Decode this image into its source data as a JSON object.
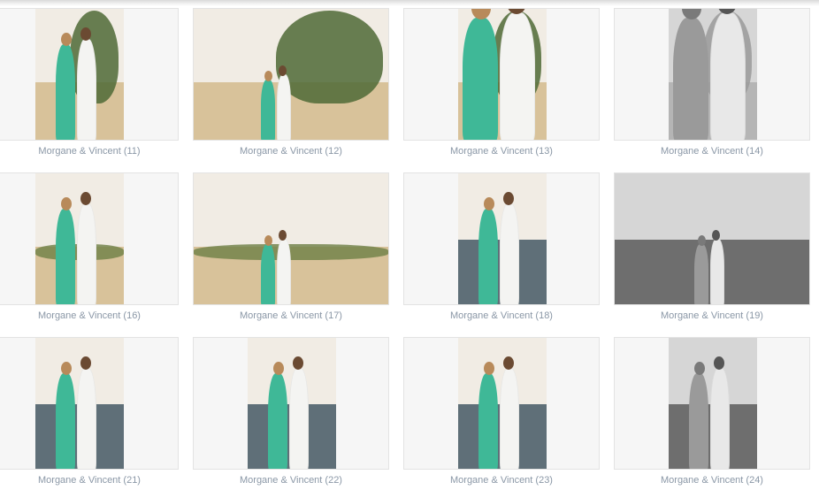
{
  "colors": {
    "dress": "#3fb897",
    "shirt": "#f4f4f2",
    "sand": "#d8c29a",
    "sky": "#f1ece4",
    "sea": "#5f6f78",
    "palm": "#4f6a36",
    "caption": "#8a97a6"
  },
  "gallery": {
    "items": [
      {
        "caption": "Morgane & Vincent (11)",
        "orientation": "portrait",
        "tone": "color",
        "scene": "palm-sand"
      },
      {
        "caption": "Morgane & Vincent (12)",
        "orientation": "landscape",
        "tone": "color",
        "scene": "palm-sand"
      },
      {
        "caption": "Morgane & Vincent (13)",
        "orientation": "portrait",
        "tone": "color",
        "scene": "palm-close"
      },
      {
        "caption": "Morgane & Vincent (14)",
        "orientation": "portrait",
        "tone": "bw",
        "scene": "palm-close"
      },
      {
        "caption": "Morgane & Vincent (16)",
        "orientation": "portrait",
        "tone": "color",
        "scene": "dunes"
      },
      {
        "caption": "Morgane & Vincent (17)",
        "orientation": "landscape",
        "tone": "color",
        "scene": "dunes"
      },
      {
        "caption": "Morgane & Vincent (18)",
        "orientation": "portrait",
        "tone": "color",
        "scene": "beach"
      },
      {
        "caption": "Morgane & Vincent (19)",
        "orientation": "landscape",
        "tone": "bw",
        "scene": "beach-close"
      },
      {
        "caption": "Morgane & Vincent (21)",
        "orientation": "portrait",
        "tone": "color",
        "scene": "beach"
      },
      {
        "caption": "Morgane & Vincent (22)",
        "orientation": "portrait",
        "tone": "color",
        "scene": "beach"
      },
      {
        "caption": "Morgane & Vincent (23)",
        "orientation": "portrait",
        "tone": "color",
        "scene": "beach"
      },
      {
        "caption": "Morgane & Vincent (24)",
        "orientation": "portrait",
        "tone": "bw",
        "scene": "beach"
      }
    ]
  }
}
